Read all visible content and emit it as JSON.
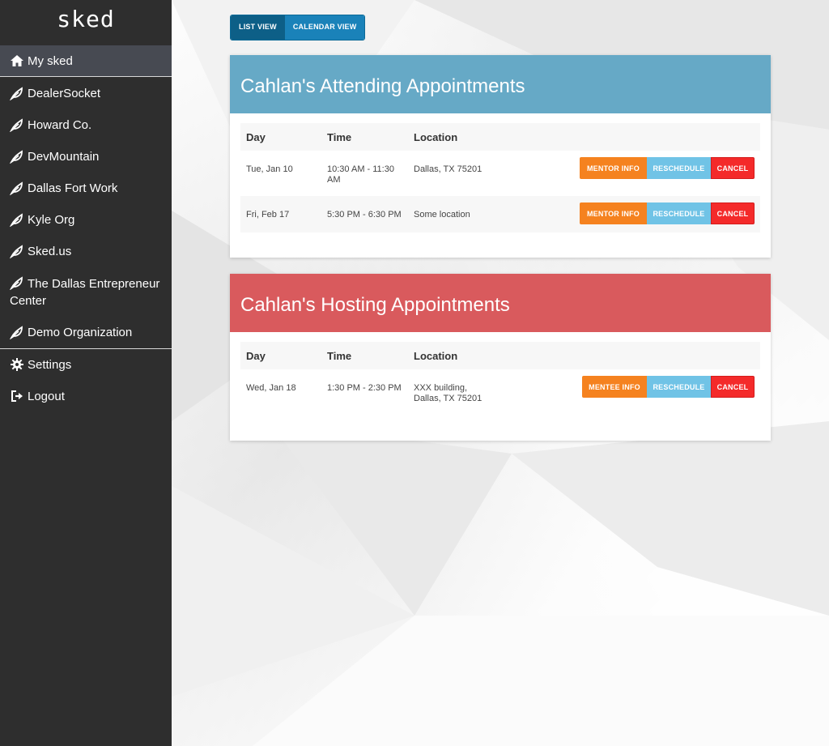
{
  "app": {
    "logo": "sked"
  },
  "sidebar": {
    "items": [
      {
        "label": "My sked",
        "icon": "home-icon"
      },
      {
        "label": "DealerSocket",
        "icon": "leaf-icon"
      },
      {
        "label": "Howard Co.",
        "icon": "leaf-icon"
      },
      {
        "label": "DevMountain",
        "icon": "leaf-icon"
      },
      {
        "label": "Dallas Fort Work",
        "icon": "leaf-icon"
      },
      {
        "label": "Kyle Org",
        "icon": "leaf-icon"
      },
      {
        "label": "Sked.us",
        "icon": "leaf-icon"
      },
      {
        "label": "The Dallas Entrepreneur Center",
        "icon": "leaf-icon"
      },
      {
        "label": "Demo Organization",
        "icon": "leaf-icon"
      }
    ],
    "settings_label": "Settings",
    "logout_label": "Logout"
  },
  "view_toggle": {
    "list": "LIST VIEW",
    "calendar": "CALENDAR VIEW"
  },
  "attending": {
    "title": "Cahlan's Attending Appointments",
    "columns": [
      "Day",
      "Time",
      "Location"
    ],
    "rows": [
      {
        "day": "Tue, Jan 10",
        "time": "10:30 AM - 11:30 AM",
        "location": "Dallas, TX 75201",
        "info_label": "MENTOR INFO",
        "reschedule_label": "RESCHEDULE",
        "cancel_label": "CANCEL"
      },
      {
        "day": "Fri, Feb 17",
        "time": "5:30 PM - 6:30 PM",
        "location": "Some location",
        "info_label": "MENTOR INFO",
        "reschedule_label": "RESCHEDULE",
        "cancel_label": "CANCEL"
      }
    ]
  },
  "hosting": {
    "title": "Cahlan's Hosting Appointments",
    "columns": [
      "Day",
      "Time",
      "Location"
    ],
    "rows": [
      {
        "day": "Wed, Jan 18",
        "time": "1:30 PM - 2:30 PM",
        "location_line1": "XXX building,",
        "location_line2": "Dallas, TX 75201",
        "info_label": "MENTEE INFO",
        "reschedule_label": "RESCHEDULE",
        "cancel_label": "CANCEL"
      }
    ]
  },
  "colors": {
    "sidebar_bg": "#2e2e2e",
    "attending_header": "#66a9c6",
    "hosting_header": "#d95a5d",
    "info_button": "#f5821f",
    "reschedule_button": "#70c3e6",
    "cancel_button": "#f42a2a"
  }
}
